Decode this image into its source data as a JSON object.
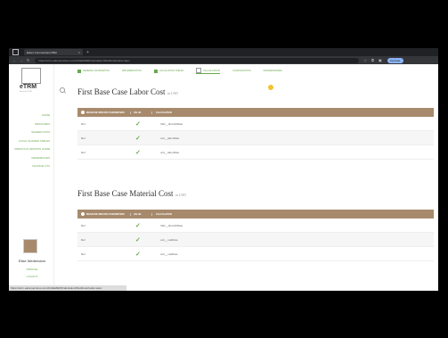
{
  "browser": {
    "tab_title": "Eaton Commercial eTRM",
    "url": "https://etrm.eatonservices.com/ACEEI/EMI/Calculation/Workbook/Labor.aspx",
    "profile": "Inprivate"
  },
  "app": {
    "logo_text": "eTRM",
    "logo_sub": "Electronic TRM",
    "sidebar_links": [
      "HOME",
      "MEASURES",
      "SHARED DATA",
      "LOCAL SHARED TABLES",
      "PREVIOUS VERSION HOME",
      "REFERENCES",
      "CHANGE LOG"
    ],
    "user_name": "Elise Wedemann",
    "user_links": [
      "PROFILE",
      "LOGOUT"
    ]
  },
  "steps": [
    "GENERAL INFORMATION",
    "IMPLEMENTATION",
    "CALCULATION TABLES",
    "CALCULATIONS",
    "CONSOLIDATION",
    "PARAMETERIZED"
  ],
  "sections": [
    {
      "title": "First Base Case Labor Cost",
      "unit": "in USD",
      "headers": [
        "MEASURE SPECIFIC PARAMETERS",
        "VALUE",
        "CALCULATION"
      ],
      "rows": [
        {
          "param": "Ref",
          "calc": "Val1__RetrofitRate"
        },
        {
          "param": "Ref",
          "calc": "unit__laborRate"
        },
        {
          "param": "Ref",
          "calc": "unit__laborRate"
        }
      ]
    },
    {
      "title": "First Base Case Material Cost",
      "unit": "in USD",
      "headers": [
        "MEASURE SPECIFIC PARAMETERS",
        "VALUE",
        "CALCULATION"
      ],
      "rows": [
        {
          "param": "Ref",
          "calc": "Val1__RetrofitRate"
        },
        {
          "param": "Ref",
          "calc": "unit__matRate"
        },
        {
          "param": "Ref",
          "calc": "unit__matRate"
        }
      ]
    }
  ],
  "status_url": "https://etrm.eatonservices.com/ACEEI/EMI/Calculation/Workbook/Labor.aspx"
}
